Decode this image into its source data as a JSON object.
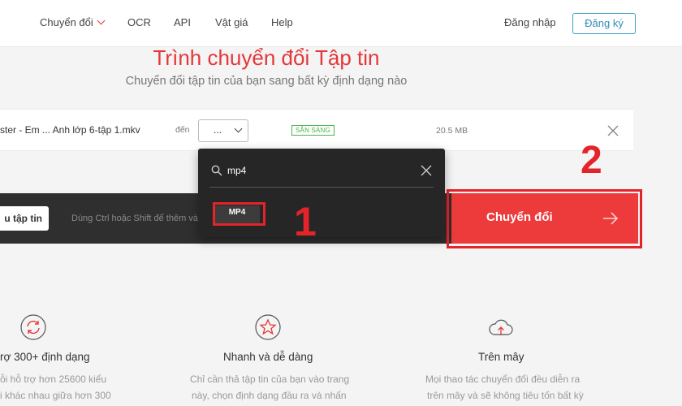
{
  "nav": {
    "items": [
      "Chuyển đổi",
      "OCR",
      "API",
      "Vật giá",
      "Help"
    ],
    "login": "Đăng nhập",
    "signup": "Đăng ký"
  },
  "hero": {
    "title": "Trình chuyển đổi Tập tin",
    "subtitle": "Chuyển đổi tập tin của bạn sang bất kỳ định dạng nào"
  },
  "file": {
    "name": "ster - Em ... Anh lớp 6-tập 1.mkv",
    "to_label": "đến",
    "format_value": "...",
    "status": "SẴN SÀNG",
    "size": "20.5 MB"
  },
  "actions": {
    "add_file": "u tập tin",
    "hint": "Dùng Ctrl hoặc Shift để thêm vài",
    "convert": "Chuyển đổi"
  },
  "dropdown": {
    "search_value": "mp4",
    "options": [
      "MP4"
    ]
  },
  "annotations": {
    "step1": "1",
    "step2": "2"
  },
  "features": [
    {
      "icon": "refresh-icon",
      "title": "rợ 300+ định dạng",
      "desc": [
        "ỗi hỗ trợ hơn 25600 kiểu",
        "i khác nhau giữa hơn 300"
      ]
    },
    {
      "icon": "star-icon",
      "title": "Nhanh và dễ dàng",
      "desc": [
        "Chỉ cần thả tập tin của bạn vào trang",
        "này, chọn định dạng đầu ra và nhấn"
      ]
    },
    {
      "icon": "cloud-upload-icon",
      "title": "Trên mây",
      "desc": [
        "Mọi thao tác chuyển đổi đều diễn ra",
        "trên mây và sẽ không tiêu tốn bất kỳ"
      ]
    }
  ],
  "colors": {
    "accent": "#e4373a",
    "convert_bg": "#ed3b3b",
    "annotation": "#e4232a",
    "ready": "#49b24a",
    "signup_border": "#3aa0c8"
  }
}
